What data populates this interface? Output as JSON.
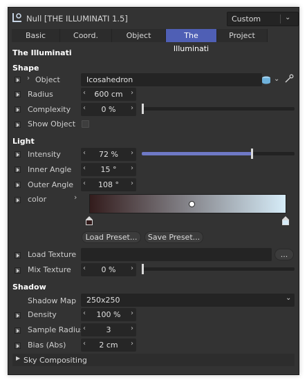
{
  "window": {
    "title": "Null [THE ILLUMINATI 1.5]",
    "preset": {
      "selected": "Custom"
    }
  },
  "tabs": [
    {
      "label": "Basic",
      "active": false
    },
    {
      "label": "Coord.",
      "active": false
    },
    {
      "label": "Object",
      "active": false
    },
    {
      "label": "The Illuminati",
      "active": true
    },
    {
      "label": "Project",
      "active": false
    }
  ],
  "group_title": "The Illuminati",
  "shape": {
    "heading": "Shape",
    "object_label": "Object",
    "object_value": "Icosahedron",
    "radius_label": "Radius",
    "radius_value": "600 cm",
    "complexity_label": "Complexity",
    "complexity_value": "0 %",
    "complexity_fraction": 0.0,
    "show_object_label": "Show Object",
    "show_object_checked": false
  },
  "light": {
    "heading": "Light",
    "intensity_label": "Intensity",
    "intensity_value": "72 %",
    "intensity_fraction": 0.72,
    "inner_angle_label": "Inner Angle",
    "inner_angle_value": "15 °",
    "outer_angle_label": "Outer Angle",
    "outer_angle_value": "108 °",
    "color_label": "color",
    "gradient_start": "#331c1c",
    "gradient_end": "#d6ecf8",
    "load_preset": "Load Preset...",
    "save_preset": "Save Preset...",
    "load_texture_label": "Load Texture",
    "browse_label": "...",
    "mix_texture_label": "Mix Texture",
    "mix_texture_value": "0 %",
    "mix_texture_fraction": 0.0
  },
  "shadow": {
    "heading": "Shadow",
    "shadow_map_label": "Shadow Map",
    "shadow_map_value": "250x250",
    "density_label": "Density",
    "density_value": "100 %",
    "sample_radius_label": "Sample Radius",
    "sample_radius_value": "3",
    "bias_label": "Bias (Abs)",
    "bias_value": "2 cm"
  },
  "sky_compositing_label": "Sky Compositing",
  "colors": {
    "accent": "#4f5fb5",
    "panel_bg": "#333333",
    "field_bg": "#242424"
  }
}
